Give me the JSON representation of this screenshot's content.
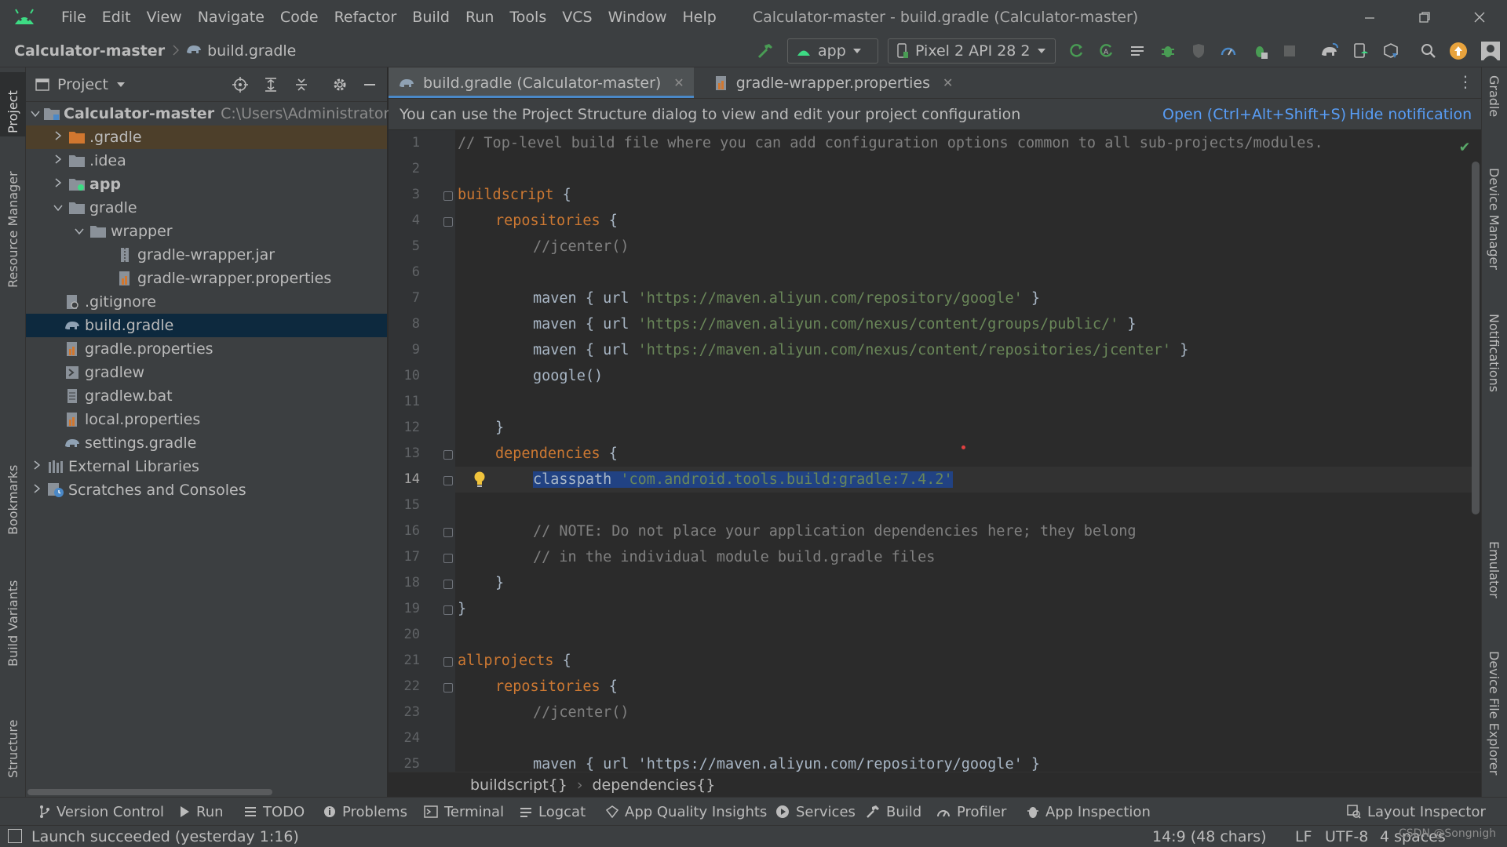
{
  "app": {
    "menu": [
      "File",
      "Edit",
      "View",
      "Navigate",
      "Code",
      "Refactor",
      "Build",
      "Run",
      "Tools",
      "VCS",
      "Window",
      "Help"
    ],
    "window_title": "Calculator-master - build.gradle (Calculator-master)"
  },
  "navbar": {
    "project": "Calculator-master",
    "file": "build.gradle",
    "run_config": "app",
    "device": "Pixel 2 API 28 2"
  },
  "left_stripe": [
    "Project",
    "Resource Manager",
    "Bookmarks",
    "Build Variants",
    "Structure"
  ],
  "right_stripe": [
    "Gradle",
    "Device Manager",
    "Notifications",
    "Emulator",
    "Device File Explorer"
  ],
  "project_panel": {
    "title": "Project",
    "tree": [
      {
        "label": "Calculator-master",
        "path": "C:\\Users\\Administrator\\De",
        "bold": true
      },
      {
        "label": ".gradle"
      },
      {
        "label": ".idea"
      },
      {
        "label": "app",
        "bold": true
      },
      {
        "label": "gradle"
      },
      {
        "label": "wrapper"
      },
      {
        "label": "gradle-wrapper.jar"
      },
      {
        "label": "gradle-wrapper.properties"
      },
      {
        "label": ".gitignore"
      },
      {
        "label": "build.gradle"
      },
      {
        "label": "gradle.properties"
      },
      {
        "label": "gradlew"
      },
      {
        "label": "gradlew.bat"
      },
      {
        "label": "local.properties"
      },
      {
        "label": "settings.gradle"
      },
      {
        "label": "External Libraries"
      },
      {
        "label": "Scratches and Consoles"
      }
    ]
  },
  "editor": {
    "tabs": [
      "build.gradle (Calculator-master)",
      "gradle-wrapper.properties"
    ],
    "notification": {
      "message": "You can use the Project Structure dialog to view and edit your project configuration",
      "open_link": "Open (Ctrl+Alt+Shift+S)",
      "hide_link": "Hide notification"
    },
    "line_numbers": [
      "1",
      "2",
      "3",
      "4",
      "5",
      "6",
      "7",
      "8",
      "9",
      "10",
      "11",
      "12",
      "13",
      "14",
      "15",
      "16",
      "17",
      "18",
      "19",
      "20",
      "21",
      "22",
      "23",
      "24",
      "25"
    ],
    "code": {
      "l1": "// Top-level build file where you can add configuration options common to all sub-projects/modules.",
      "l3_kw": "buildscript",
      "l3_rest": " {",
      "l4_kw": "repositories",
      "l4_rest": " {",
      "l5": "//jcenter()",
      "maven_prefix": "maven { url ",
      "maven_suffix": " }",
      "l7_str": "'https://maven.aliyun.com/repository/google'",
      "l8_str": "'https://maven.aliyun.com/nexus/content/groups/public/'",
      "l9_str": "'https://maven.aliyun.com/nexus/content/repositories/jcenter'",
      "l10": "google()",
      "l12": "}",
      "l13_kw": "dependencies",
      "l13_rest": " {",
      "l14_ident": "classpath",
      "l14_str": "'com.android.tools.build:gradle:7.4.2'",
      "l16": "// NOTE: Do not place your application dependencies here; they belong",
      "l17": "// in the individual module build.gradle files",
      "l18": "}",
      "l19": "}",
      "l21_kw": "allprojects",
      "l21_rest": " {",
      "l22_kw": "repositories",
      "l22_rest": " {",
      "l23": "//jcenter()",
      "l25": "maven { url 'https://maven.aliyun.com/repository/google' }"
    },
    "breadcrumbs": [
      "buildscript{}",
      "dependencies{}"
    ]
  },
  "bottom_tools": [
    "Version Control",
    "Run",
    "TODO",
    "Problems",
    "Terminal",
    "Logcat",
    "App Quality Insights",
    "Services",
    "Build",
    "Profiler",
    "App Inspection",
    "Layout Inspector"
  ],
  "status": {
    "message": "Launch succeeded (yesterday 1:16)",
    "position": "14:9 (48 chars)",
    "line_sep": "LF",
    "encoding": "UTF-8",
    "indent": "4 spaces",
    "watermark": "CSDN @Songnigh"
  },
  "colors": {
    "accent": "#4a88c7",
    "link": "#589df6",
    "keyword": "#cc7832",
    "string": "#6a8759",
    "comment": "#808080",
    "selection": "#214283",
    "run_green": "#499c54"
  }
}
